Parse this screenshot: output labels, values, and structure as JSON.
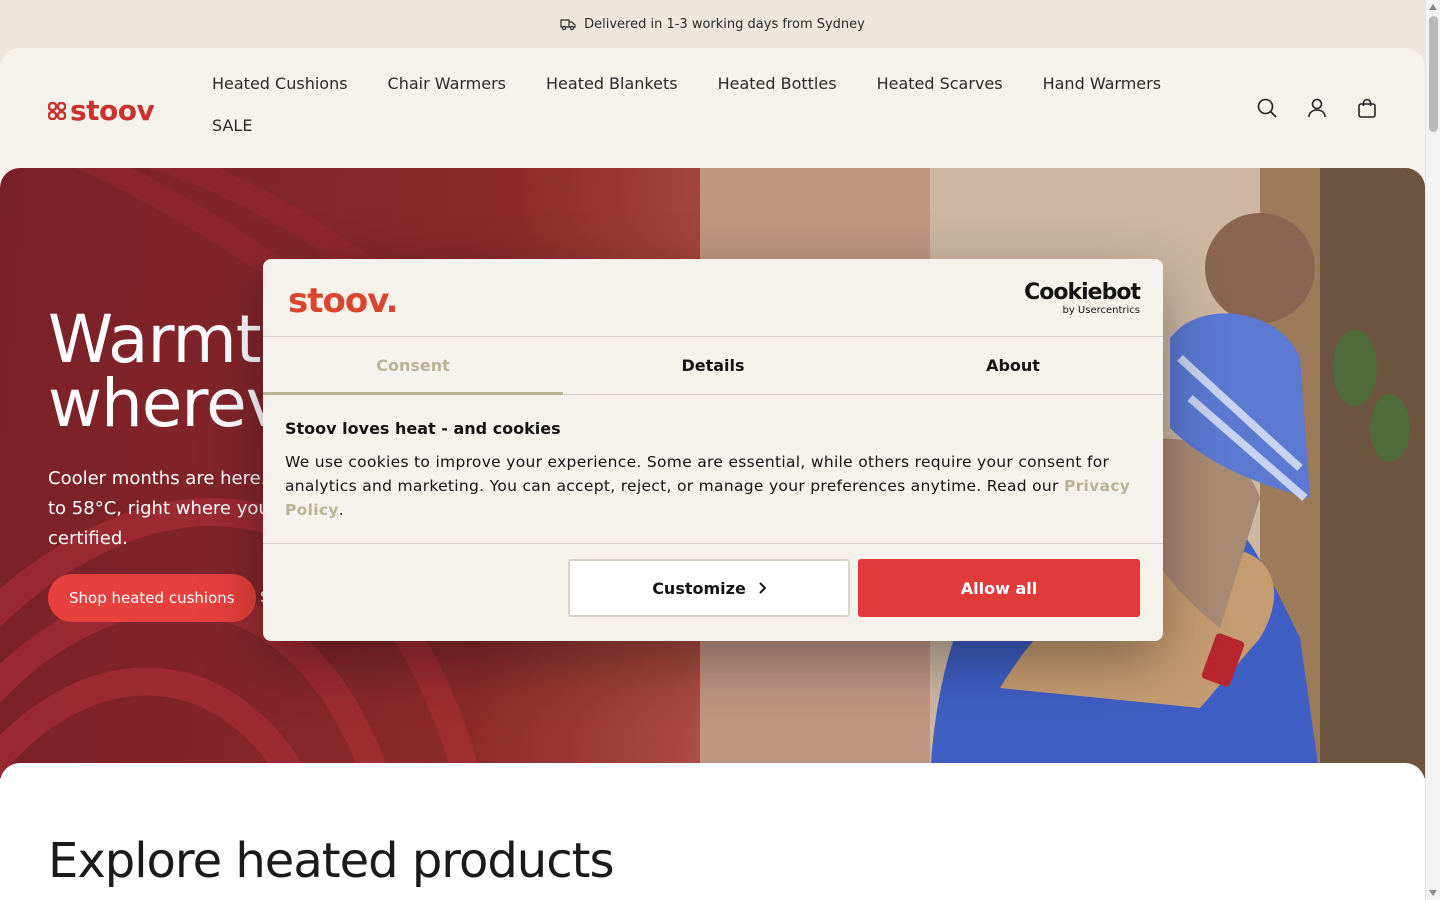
{
  "announcement": {
    "text": "Delivered in 1-3 working days from Sydney",
    "icon": "truck-icon"
  },
  "header": {
    "logo": "stoov",
    "nav": [
      "Heated Cushions",
      "Chair Warmers",
      "Heated Blankets",
      "Heated Bottles",
      "Heated Scarves",
      "Hand Warmers",
      "SALE"
    ],
    "icons": [
      "search-icon",
      "account-icon",
      "cart-icon"
    ]
  },
  "hero": {
    "title_line1": "Warmth",
    "title_line2": "wherever",
    "subtitle_line1": "Cooler months are here. S",
    "subtitle_line2": "to 58°C, right where you n",
    "subtitle_line3": "certified.",
    "cta_primary": "Shop heated cushions",
    "cta_secondary": "S"
  },
  "explore": {
    "title": "Explore heated products"
  },
  "cookie_dialog": {
    "logo": "stoov.",
    "provider_name": "Cookiebot",
    "provider_by": "by Usercentrics",
    "tabs": [
      "Consent",
      "Details",
      "About"
    ],
    "active_tab": "Consent",
    "heading": "Stoov loves heat - and cookies",
    "body": "We use cookies to improve your experience. Some are essential, while others require your consent for analytics and marketing. You can accept, reject, or manage your preferences anytime. Read our ",
    "link_text": "Privacy Policy",
    "body_end": ".",
    "customize_label": "Customize",
    "allow_label": "Allow all"
  },
  "colors": {
    "brand_red": "#c9332f",
    "allow_button": "#e03a3a",
    "accent_olive": "#b7b394",
    "cream": "#f5f2ec"
  }
}
